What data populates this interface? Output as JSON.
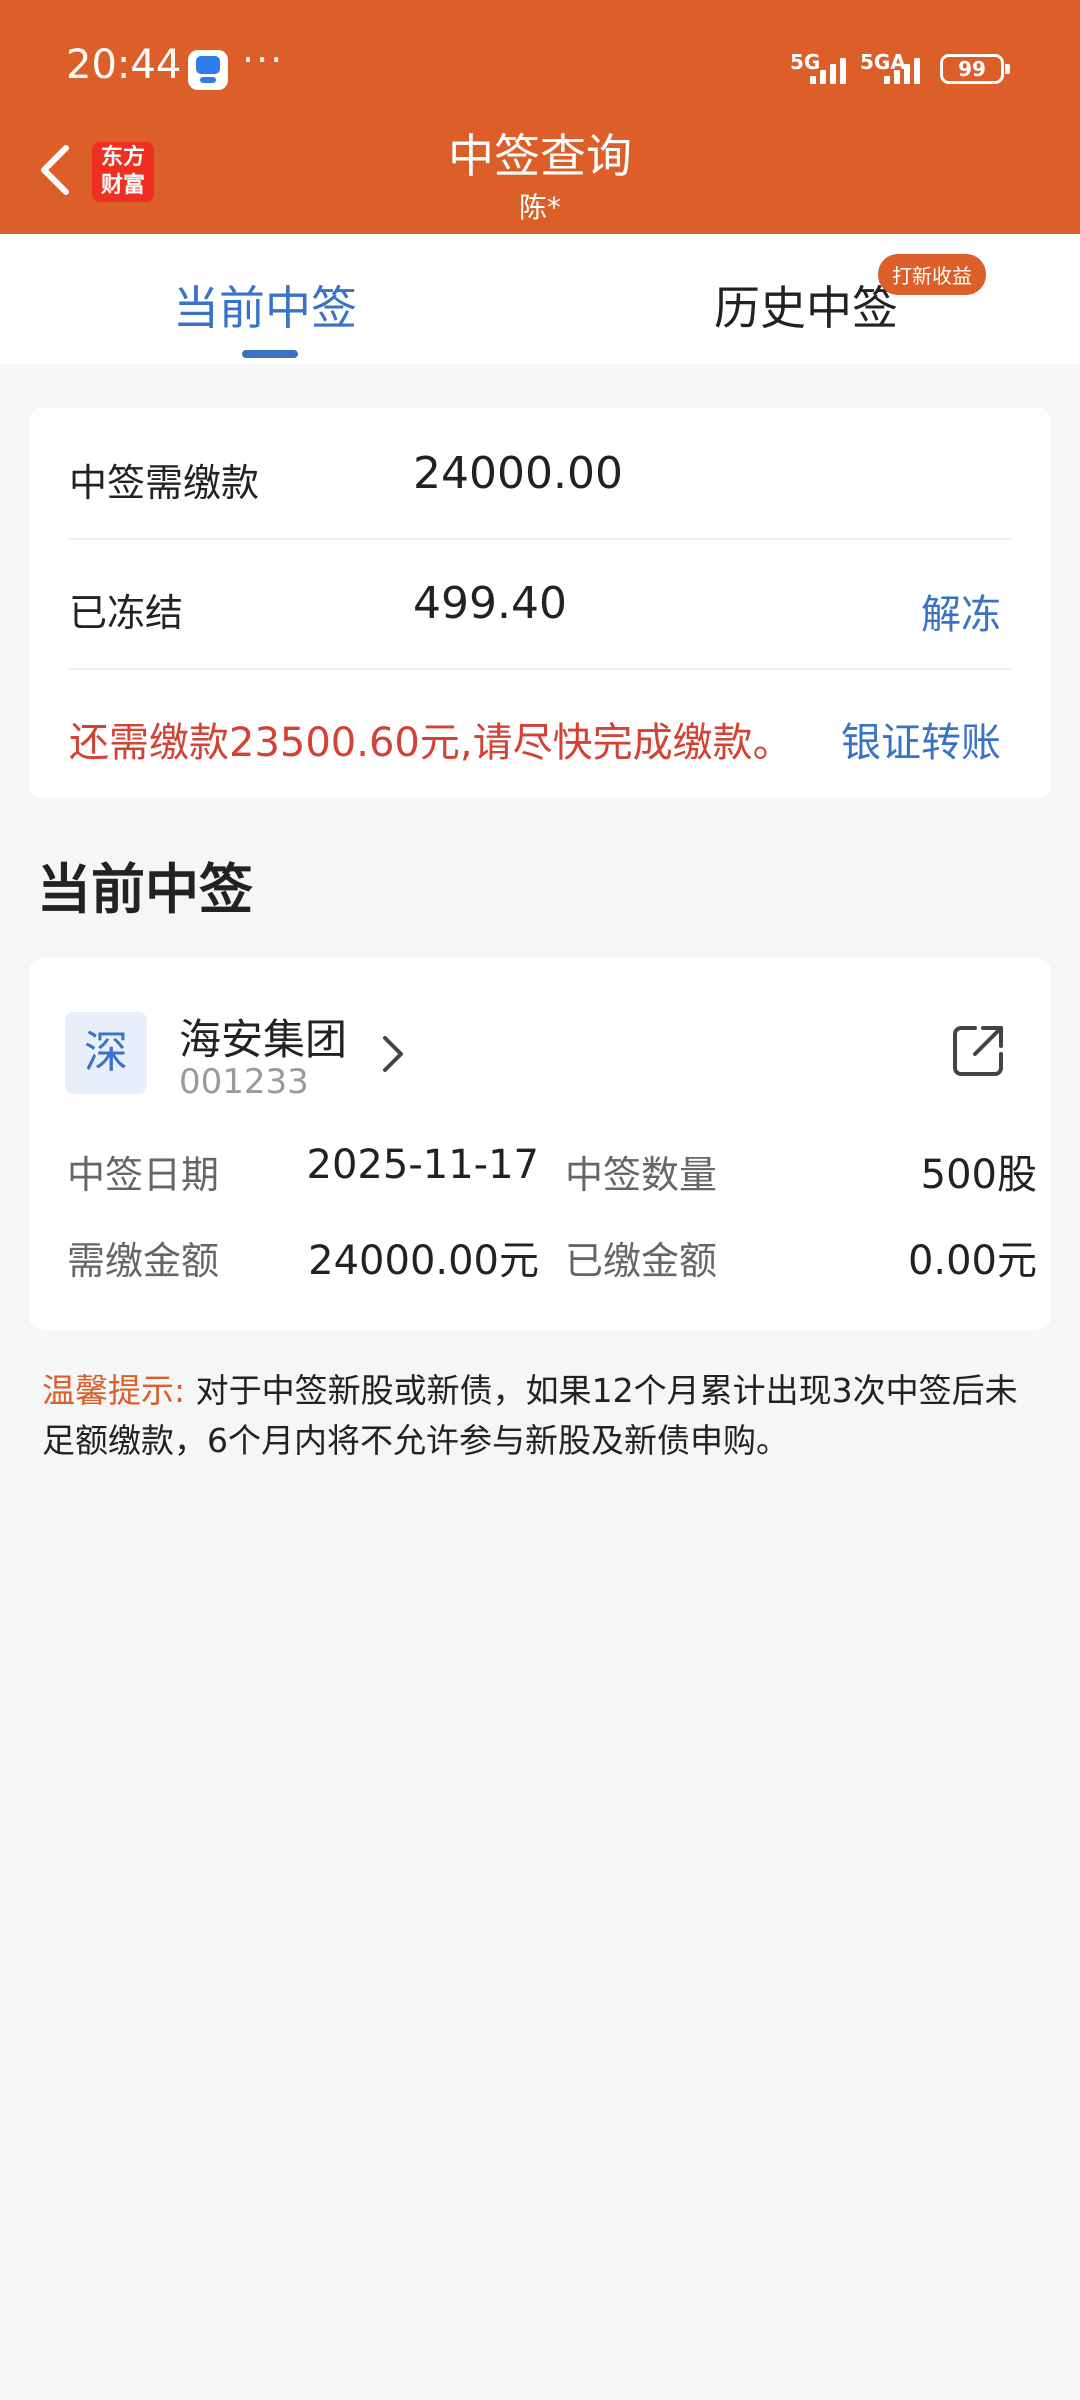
{
  "status_bar": {
    "time": "20:44",
    "dots": "···",
    "net1": "5G",
    "net2": "5GA",
    "battery": "99"
  },
  "header": {
    "logo_line1": "东方",
    "logo_line2": "财富",
    "title": "中签查询",
    "subtitle": "陈*"
  },
  "tabs": {
    "current": "当前中签",
    "history": "历史中签",
    "history_badge": "打新收益"
  },
  "summary": {
    "payable_label": "中签需缴款",
    "payable_value": "24000.00",
    "frozen_label": "已冻结",
    "frozen_value": "499.40",
    "unfreeze_link": "解冻",
    "warning": "还需缴款23500.60元,请尽快完成缴款。",
    "transfer_link": "银证转账"
  },
  "section": {
    "title": "当前中签"
  },
  "stock": {
    "market": "深",
    "name": "海安集团",
    "code": "001233",
    "date_label": "中签日期",
    "date_value": "2025-11-17",
    "qty_label": "中签数量",
    "qty_value": "500股",
    "need_label": "需缴金额",
    "need_value": "24000.00元",
    "paid_label": "已缴金额",
    "paid_value": "0.00元"
  },
  "tip": {
    "label": "温馨提示:",
    "text": "对于中签新股或新债，如果12个月累计出现3次中签后未足额缴款，6个月内将不允许参与新股及新债申购。"
  }
}
